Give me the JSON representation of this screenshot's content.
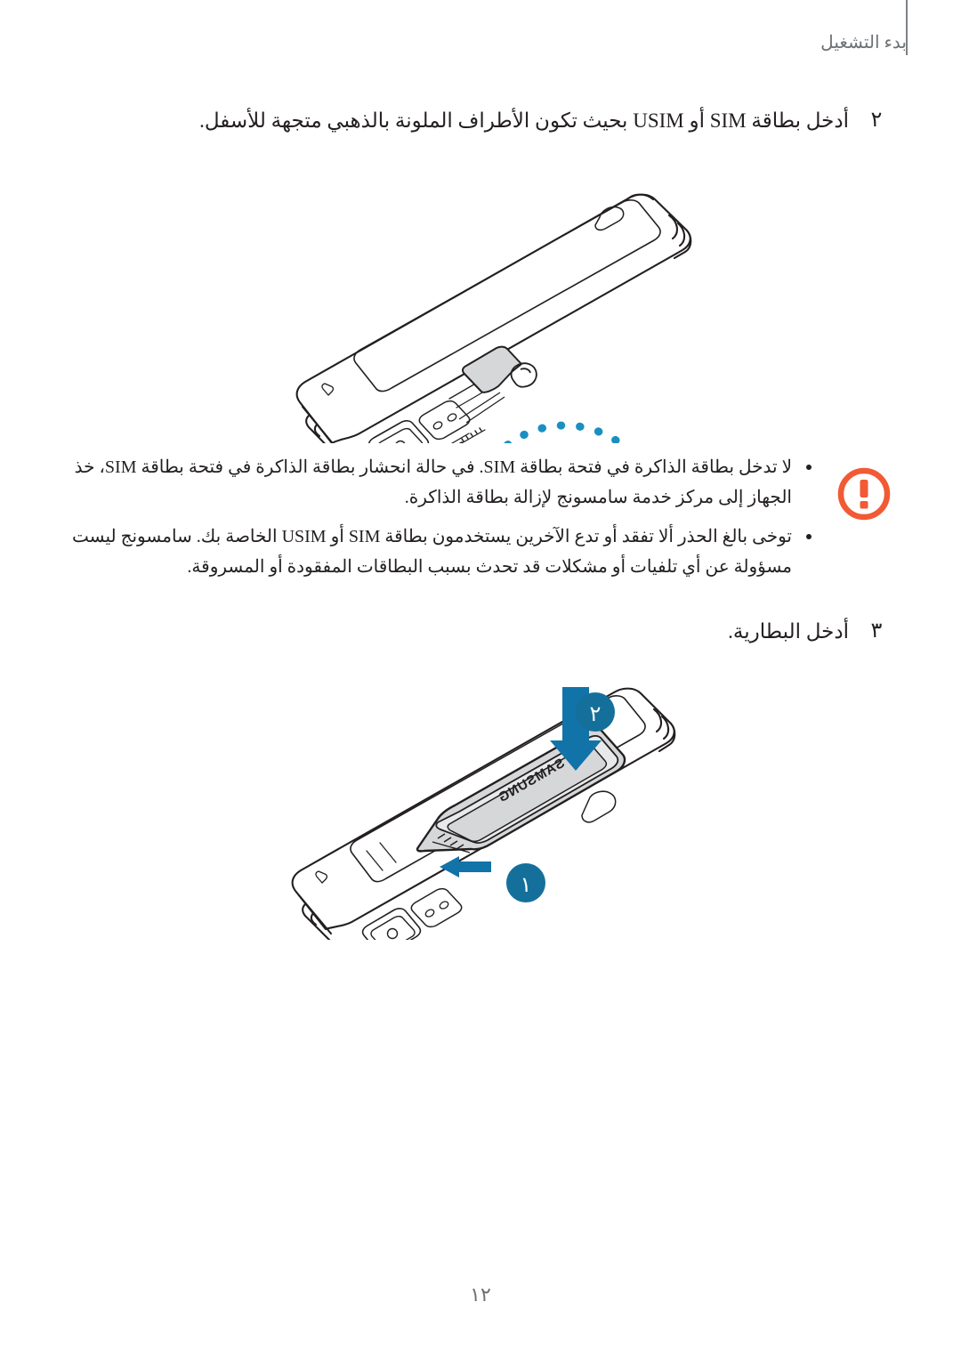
{
  "header": {
    "title": "بدء التشغيل"
  },
  "steps": [
    {
      "number": "٢",
      "text": "أدخل بطاقة SIM أو USIM بحيث تكون الأطراف الملونة بالذهبي متجهة للأسفل."
    },
    {
      "number": "٣",
      "text": "أدخل البطارية."
    }
  ],
  "caution": {
    "icon_name": "warning-exclamation-icon",
    "icon_color": "#f15a34",
    "items": [
      "لا تدخل بطاقة الذاكرة في فتحة بطاقة SIM. في حالة انحشار بطاقة الذاكرة في فتحة بطاقة SIM، خذ الجهاز إلى مركز خدمة سامسونج لإزالة بطاقة الذاكرة.",
      "توخى بالغ الحذر ألا تفقد أو تدع الآخرين يستخدمون بطاقة SIM أو USIM الخاصة بك. سامسونج ليست مسؤولة عن أي تلفيات أو مشكلات قد تحدث بسبب البطاقات المفقودة أو المسروقة."
    ]
  },
  "figures": {
    "sim_insertion": {
      "name": "sim-card-insertion-illustration",
      "callout_circle": "detail-magnifier-circle",
      "arrow_color": "#1273a8",
      "sim_card_fill": "#d5d7d9",
      "device_outline": "#231f20"
    },
    "battery_insertion": {
      "name": "battery-insertion-illustration",
      "battery_label": "SAMSUNG",
      "badge_color": "#14709b",
      "badges": [
        {
          "label": "١"
        },
        {
          "label": "٢"
        }
      ],
      "arrow_color": "#1273a8",
      "battery_fill": "#d5d7d9"
    }
  },
  "page_number": "١٢"
}
